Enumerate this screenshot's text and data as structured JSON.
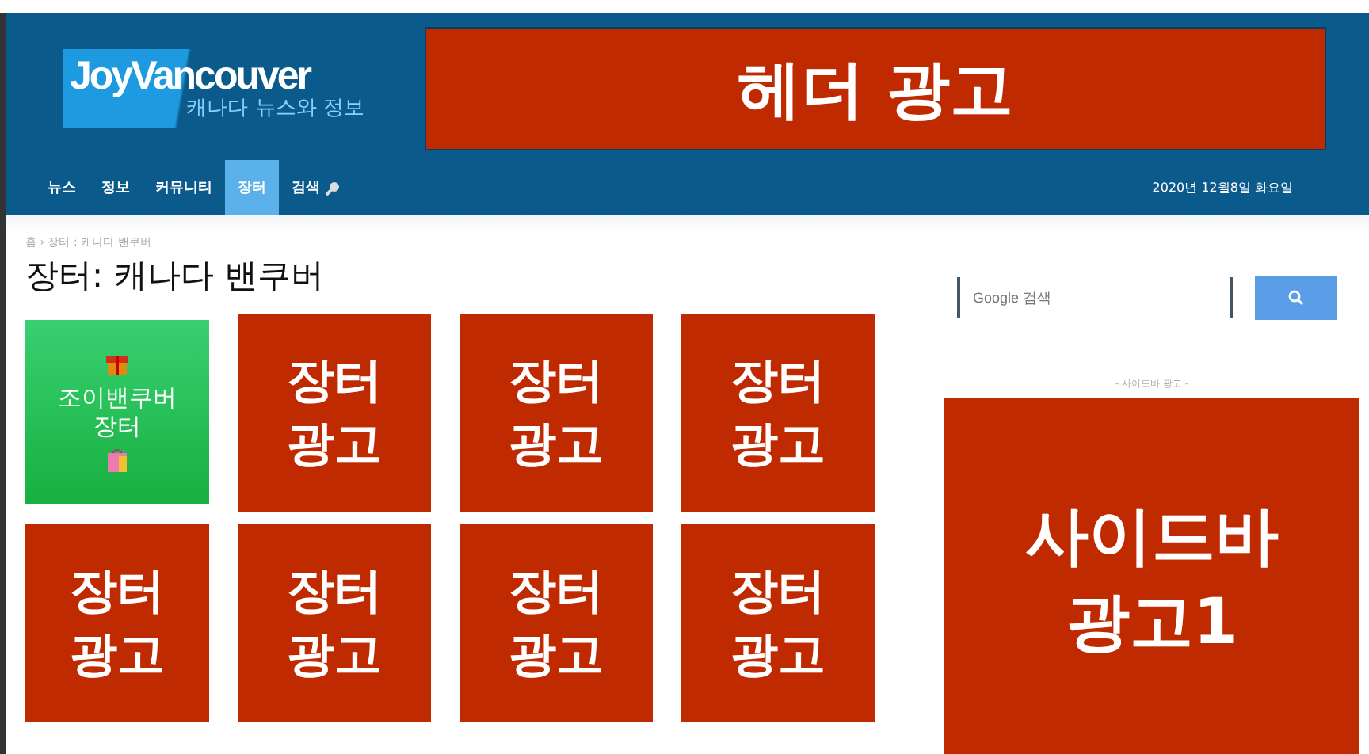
{
  "header": {
    "logo": {
      "title": "JoyVancouver",
      "subtitle": "캐나다 뉴스와 정보"
    },
    "banner": "헤더 광고"
  },
  "nav": {
    "items": [
      {
        "kind": "text",
        "label": "뉴스",
        "selected": false
      },
      {
        "kind": "text",
        "label": "정보",
        "selected": false
      },
      {
        "kind": "text",
        "label": "커뮤니티",
        "selected": false
      },
      {
        "kind": "text",
        "label": "장터",
        "selected": true
      },
      {
        "kind": "search",
        "label": "검색",
        "selected": false
      }
    ],
    "date": "2020년 12월8일 화요일"
  },
  "breadcrumb": "홈 › 장터 : 캐나다 밴쿠버",
  "title": "장터: 캐나다 밴쿠버",
  "tiles": [
    {
      "kind": "promo",
      "text": "조이밴쿠버 장터"
    },
    {
      "kind": "ad",
      "text": "장터 광고"
    },
    {
      "kind": "ad",
      "text": "장터 광고"
    },
    {
      "kind": "ad",
      "text": "장터 광고"
    },
    {
      "kind": "ad",
      "text": "장터 광고"
    },
    {
      "kind": "ad",
      "text": "장터 광고"
    },
    {
      "kind": "ad",
      "text": "장터 광고"
    },
    {
      "kind": "ad",
      "text": "장터 광고"
    }
  ],
  "sidebar": {
    "search": {
      "placeholder": "Google 검색"
    },
    "ad_label": "- 사이드바 광고 -",
    "ad": "사이드바 광고1"
  }
}
